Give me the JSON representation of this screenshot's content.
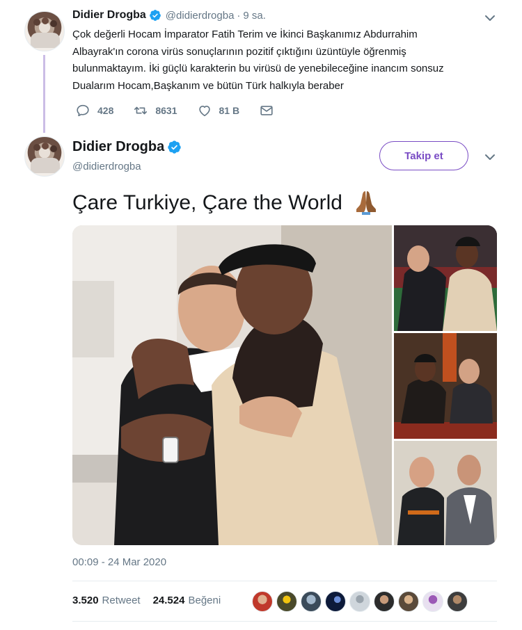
{
  "reply_tweet": {
    "author_name": "Didier Drogba",
    "author_handle": "@didierdrogba",
    "time_ago": "9 sa.",
    "text_lines": [
      "Çok değerli Hocam İmparator Fatih Terim ve İkinci Başkanımız Abdurrahim",
      "Albayrak'ın corona virüs sonuçlarının pozitif çıktığını üzüntüyle öğrenmiş",
      "bulunmaktayım. İki güçlü karakterin bu virüsü de yenebileceğine inancım sonsuz",
      "Dualarım Hocam,Başkanım ve bütün Türk halkıyla beraber"
    ],
    "replies": "428",
    "retweets": "8631",
    "likes": "81 B"
  },
  "main_tweet": {
    "author_name": "Didier Drogba",
    "author_handle": "@didierdrogba",
    "follow_label": "Takip et",
    "text": "Çare Turkiye, Çare the World",
    "timestamp": "00:09 - 24 Mar 2020",
    "retweet_count": "3.520",
    "retweet_label": "Retweet",
    "like_count": "24.524",
    "like_label": "Beğeni"
  },
  "colors": {
    "accent": "#794bc4",
    "verified": "#1da1f2",
    "muted": "#657786",
    "thread_line": "#cbbde6"
  },
  "icons": [
    "verified-badge-icon",
    "chevron-down-icon",
    "reply-icon",
    "retweet-icon",
    "like-icon",
    "message-icon",
    "folded-hands-emoji-icon"
  ]
}
